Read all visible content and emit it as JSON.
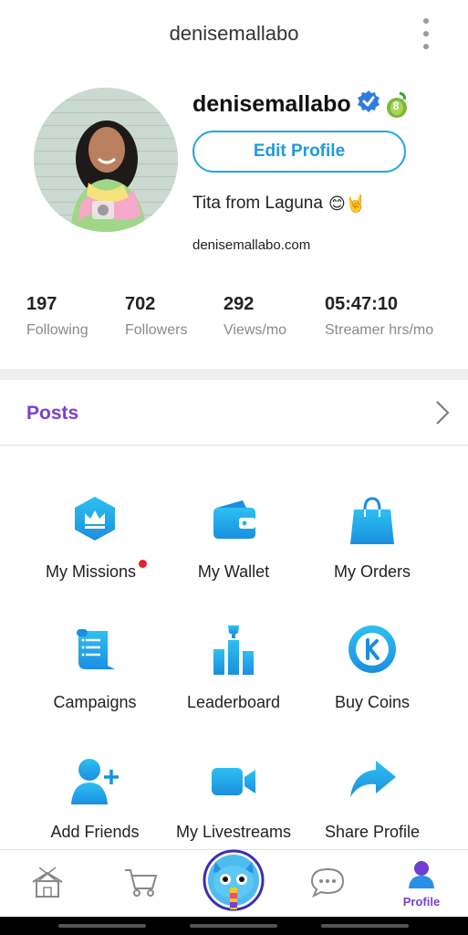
{
  "header": {
    "title": "denisemallabo",
    "more_icon": "more-vertical-icon"
  },
  "profile": {
    "username": "denisemallabo",
    "level_badge": "8",
    "edit_button": "Edit Profile",
    "bio": "Tita from Laguna",
    "bio_emojis": "😊🤘",
    "website": "denisemallabo.com"
  },
  "stats": [
    {
      "value": "197",
      "label": "Following"
    },
    {
      "value": "702",
      "label": "Followers"
    },
    {
      "value": "292",
      "label": "Views/mo"
    },
    {
      "value": "05:47:10",
      "label": "Streamer hrs/mo"
    }
  ],
  "posts": {
    "label": "Posts"
  },
  "menu": [
    {
      "label": "My Missions",
      "icon": "crown-hexagon-icon",
      "has_notification": true
    },
    {
      "label": "My Wallet",
      "icon": "wallet-icon"
    },
    {
      "label": "My Orders",
      "icon": "shopping-bag-icon"
    },
    {
      "label": "Campaigns",
      "icon": "scroll-icon"
    },
    {
      "label": "Leaderboard",
      "icon": "leaderboard-trophy-icon"
    },
    {
      "label": "Buy Coins",
      "icon": "coin-k-icon"
    },
    {
      "label": "Add Friends",
      "icon": "add-friend-icon"
    },
    {
      "label": "My Livestreams",
      "icon": "video-camera-icon"
    },
    {
      "label": "Share Profile",
      "icon": "share-arrow-icon"
    }
  ],
  "bottom_nav": {
    "items": [
      "home-icon",
      "cart-icon",
      "live-mascot-icon",
      "chat-icon",
      "profile-icon"
    ],
    "active_label": "Profile"
  },
  "colors": {
    "accent_blue": "#1d9bdc",
    "accent_purple": "#7b3fd4",
    "notification_red": "#e8202a"
  }
}
